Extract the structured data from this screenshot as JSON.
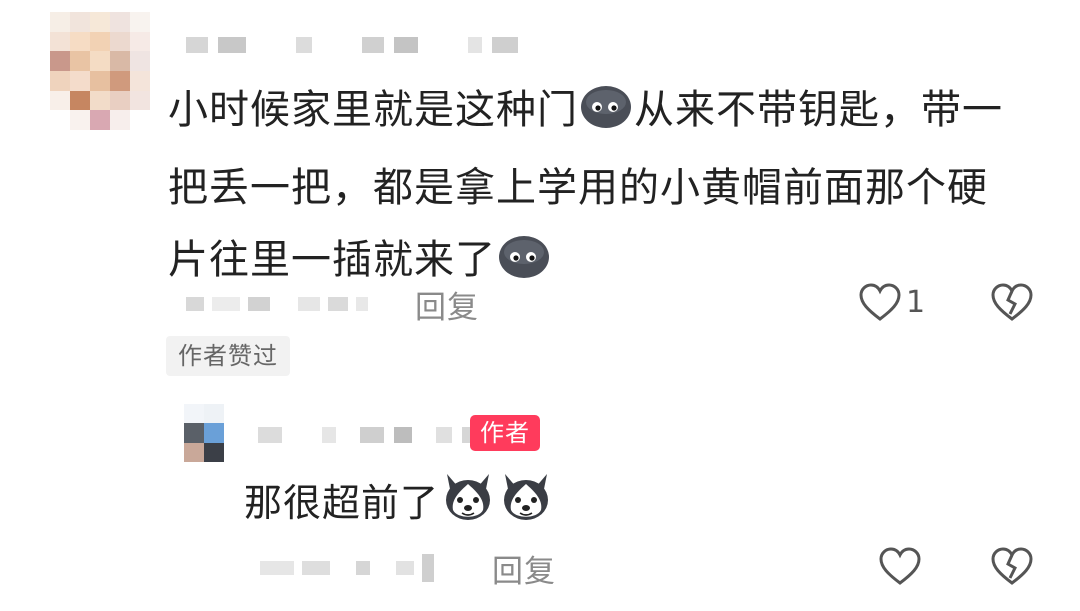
{
  "comment": {
    "text_line1_a": "小时候家里就是这种门",
    "text_line1_b": "从来不带钥匙，带一",
    "text_line2": "把丢一把，都是拿上学用的小黄帽前面那个硬",
    "text_line3": "片往里一插就来了",
    "emoji_1": "dark-face-emoji",
    "emoji_2": "dark-face-emoji",
    "reply_label": "回复",
    "like_count": "1",
    "author_liked_label": "作者赞过"
  },
  "reply": {
    "author_badge": "作者",
    "text": "那很超前了",
    "emoji_1": "husky-dog-emoji",
    "emoji_2": "husky-dog-emoji",
    "reply_label": "回复"
  },
  "icons": {
    "like": "heart-outline-icon",
    "dislike": "broken-heart-icon"
  },
  "colors": {
    "author_badge_bg": "#ff3b5c",
    "secondary_text": "#8a8a8a",
    "tag_bg": "#f2f2f2"
  }
}
